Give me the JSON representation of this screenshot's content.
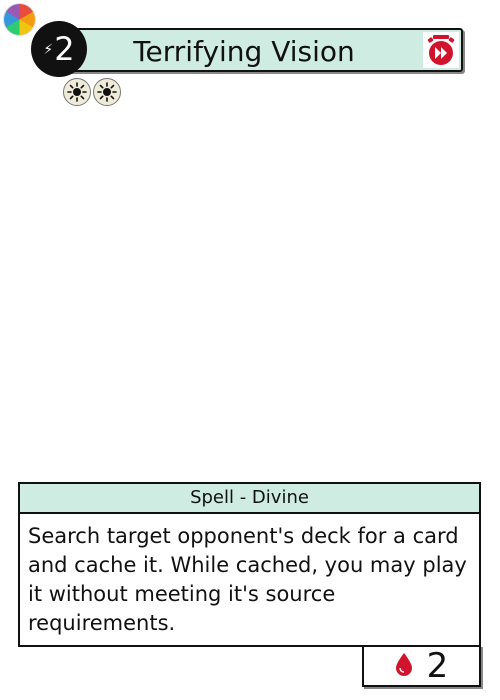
{
  "card": {
    "title": "Terrifying Vision",
    "cost": "2",
    "type_line": "Spell - Divine",
    "rules_text": "Search target opponent's deck for a card and cache it. While cached, you may play it without meeting it's source requirements.",
    "health": "2"
  },
  "icons": {
    "color_wheel": "color-wheel-icon",
    "cost_symbol": "lightning-bolt-icon",
    "exhaust": "exhaust-timer-icon",
    "sources": [
      "divine-sun-icon",
      "divine-sun-icon"
    ],
    "health_symbol": "blood-drop-icon"
  },
  "colors": {
    "header_fill": "#cfece3",
    "cost_circle": "#111111",
    "accent_red": "#d0142c",
    "source_icon_fill": "#f0ebd8"
  }
}
